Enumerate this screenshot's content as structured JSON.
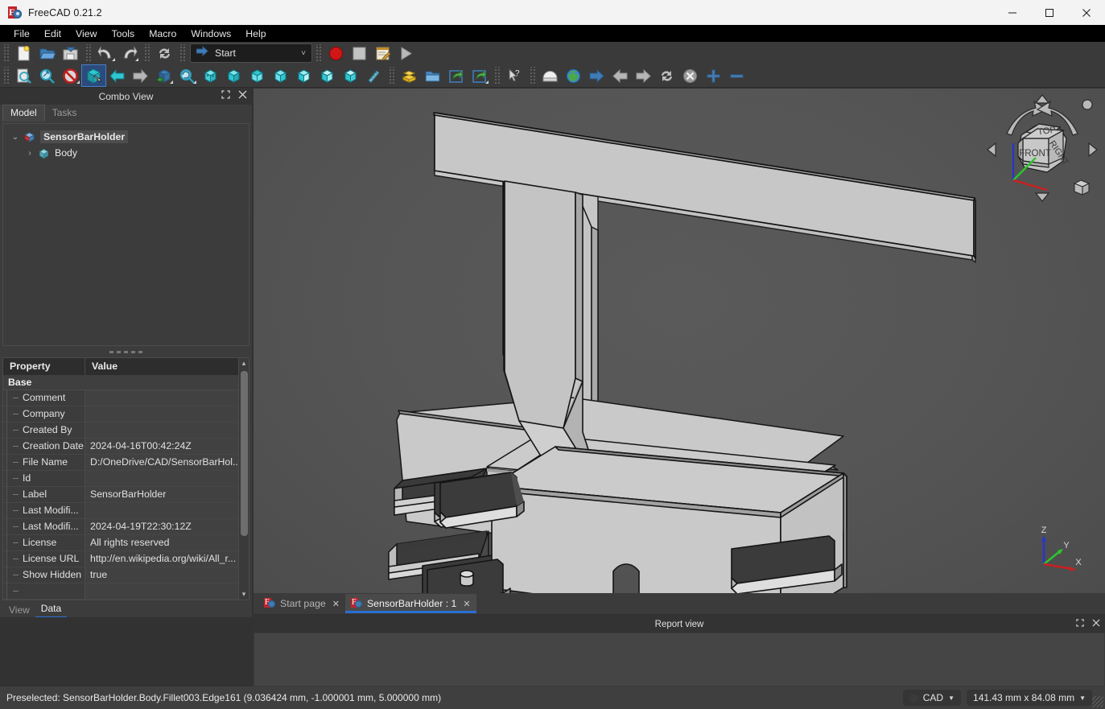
{
  "window": {
    "title": "FreeCAD 0.21.2",
    "app_icon": "freecad-logo-icon",
    "minimize": "—",
    "maximize": "□",
    "close": "✕"
  },
  "menubar": {
    "items": [
      {
        "label": "File"
      },
      {
        "label": "Edit"
      },
      {
        "label": "View"
      },
      {
        "label": "Tools"
      },
      {
        "label": "Macro"
      },
      {
        "label": "Windows"
      },
      {
        "label": "Help"
      }
    ]
  },
  "toolbar_row1": {
    "items": [
      {
        "name": "new-document-button",
        "icon": "new-file-icon"
      },
      {
        "name": "open-document-button",
        "icon": "open-folder-icon"
      },
      {
        "name": "save-document-button",
        "icon": "save-icon"
      },
      {
        "name": "undo-button",
        "icon": "undo-arrow-icon"
      },
      {
        "name": "redo-button",
        "icon": "redo-arrow-icon"
      },
      {
        "name": "refresh-button",
        "icon": "refresh-icon"
      }
    ],
    "workbench": {
      "label": "Start",
      "icon": "blue-arrow-icon",
      "chevron": "˅"
    },
    "macro_items": [
      {
        "name": "macro-record-button",
        "icon": "record-circle-icon"
      },
      {
        "name": "macro-stop-button",
        "icon": "stop-square-icon"
      },
      {
        "name": "macros-dialog-button",
        "icon": "notepad-pencil-icon"
      },
      {
        "name": "macro-execute-button",
        "icon": "play-triangle-icon"
      }
    ]
  },
  "toolbar_row2": {
    "items": [
      {
        "name": "fit-all-button",
        "icon": "fit-all-icon"
      },
      {
        "name": "fit-selection-button",
        "icon": "zoom-magnifier-icon"
      },
      {
        "name": "draw-style-button",
        "icon": "no-entry-icon"
      },
      {
        "name": "isometric-view-button",
        "icon": "axonometric-cube-icon",
        "selected": true
      },
      {
        "name": "back-navigation-button",
        "icon": "left-arrow-icon"
      },
      {
        "name": "forward-navigation-button",
        "icon": "right-arrow-icon"
      },
      {
        "name": "view-section-button",
        "icon": "cube-arrow-icon"
      },
      {
        "name": "zoom-box-button",
        "icon": "zoom-box-icon"
      },
      {
        "name": "axonometric-button",
        "icon": "dice-cube-icon"
      },
      {
        "name": "front-view-button",
        "icon": "cube-front-icon"
      },
      {
        "name": "top-view-button",
        "icon": "cube-top-icon"
      },
      {
        "name": "right-view-button",
        "icon": "cube-right-icon"
      },
      {
        "name": "rear-view-button",
        "icon": "cube-rear-icon"
      },
      {
        "name": "bottom-view-button",
        "icon": "cube-bottom-icon"
      },
      {
        "name": "left-view-button",
        "icon": "cube-left-icon"
      },
      {
        "name": "measure-button",
        "icon": "ruler-icon"
      },
      {
        "name": "std-views-button",
        "icon": "yellow-blocks-icon"
      },
      {
        "name": "group-button",
        "icon": "blue-folder-icon"
      },
      {
        "name": "link-make-button",
        "icon": "link-arrow-icon"
      },
      {
        "name": "link-actions-button",
        "icon": "link-arrow-alt-icon"
      },
      {
        "name": "whats-this-button",
        "icon": "cursor-question-icon"
      },
      {
        "name": "scene-inspector-button",
        "icon": "white-dome-icon"
      },
      {
        "name": "freecad-website-button",
        "icon": "globe-icon"
      },
      {
        "name": "navigate-forward-button",
        "icon": "blue-arrow-right-icon"
      },
      {
        "name": "tree-back-button",
        "icon": "gray-left-arrow-icon"
      },
      {
        "name": "tree-forward-button",
        "icon": "gray-right-arrow-icon"
      },
      {
        "name": "tree-refresh-button",
        "icon": "gray-refresh-icon"
      },
      {
        "name": "tree-stop-button",
        "icon": "gray-cancel-icon"
      },
      {
        "name": "zoom-in-button",
        "icon": "plus-icon"
      },
      {
        "name": "zoom-out-button",
        "icon": "minus-icon"
      }
    ]
  },
  "combo_view": {
    "title": "Combo View",
    "float_icon": "undock-icon",
    "close_icon": "close-icon",
    "tabs": [
      {
        "label": "Model",
        "active": true
      },
      {
        "label": "Tasks",
        "active": false
      }
    ],
    "tree": {
      "root": {
        "label": "SensorBarHolder",
        "icon": "document-icon",
        "twist": "⌄"
      },
      "children": [
        {
          "label": "Body",
          "icon": "body-icon",
          "twist": "›"
        }
      ]
    },
    "property_editor": {
      "headers": {
        "property": "Property",
        "value": "Value"
      },
      "group": "Base",
      "rows": [
        {
          "key": "Comment",
          "value": ""
        },
        {
          "key": "Company",
          "value": ""
        },
        {
          "key": "Created By",
          "value": ""
        },
        {
          "key": "Creation Date",
          "value": "2024-04-16T00:42:24Z"
        },
        {
          "key": "File Name",
          "value": "D:/OneDrive/CAD/SensorBarHol..."
        },
        {
          "key": "Id",
          "value": ""
        },
        {
          "key": "Label",
          "value": "SensorBarHolder"
        },
        {
          "key": "Last Modifi...",
          "value": ""
        },
        {
          "key": "Last Modifi...",
          "value": "2024-04-19T22:30:12Z"
        },
        {
          "key": "License",
          "value": "All rights reserved"
        },
        {
          "key": "License URL",
          "value": "http://en.wikipedia.org/wiki/All_r..."
        },
        {
          "key": "Show Hidden",
          "value": "true"
        }
      ],
      "scroll_up": "▴",
      "scroll_down": "▾"
    },
    "bottom_tabs": [
      {
        "label": "View",
        "active": false
      },
      {
        "label": "Data",
        "active": true
      }
    ]
  },
  "view3d": {
    "navigation_cube": {
      "face_top": "TOP",
      "face_front": "FRONT",
      "face_right": "RIGHT"
    },
    "axis_labels": {
      "x": "X",
      "y": "Y",
      "z": "Z"
    },
    "axis_colors": {
      "x": "#cc2222",
      "y": "#22bb22",
      "z": "#2233cc"
    }
  },
  "document_tabs": [
    {
      "label": "Start page",
      "active": false,
      "close": "✕",
      "icon": "freecad-doc-icon"
    },
    {
      "label": "SensorBarHolder : 1",
      "active": true,
      "close": "✕",
      "icon": "freecad-doc-icon"
    }
  ],
  "report_view": {
    "title": "Report view",
    "float_icon": "undock-icon",
    "close_icon": "close-icon",
    "content": ""
  },
  "statusbar": {
    "message": "Preselected: SensorBarHolder.Body.Fillet003.Edge161 (9.036424 mm, -1.000001 mm, 5.000000 mm)",
    "navigation_style": {
      "label": "CAD",
      "chevron": "▼"
    },
    "dimensions": {
      "label": "141.43 mm x 84.08 mm",
      "chevron": "▼"
    }
  },
  "colors": {
    "accent": "#2a6fd4",
    "titlebar_bg": "#f3f3f3",
    "menubar_bg": "#000000",
    "toolbar_bg": "#3a3a3a",
    "panel_bg": "#3c3c3c",
    "viewport_bg": "#555555",
    "model_face_light": "#c8c8c8",
    "model_face_dark": "#3a3a3a",
    "record_red": "#cc2222"
  }
}
